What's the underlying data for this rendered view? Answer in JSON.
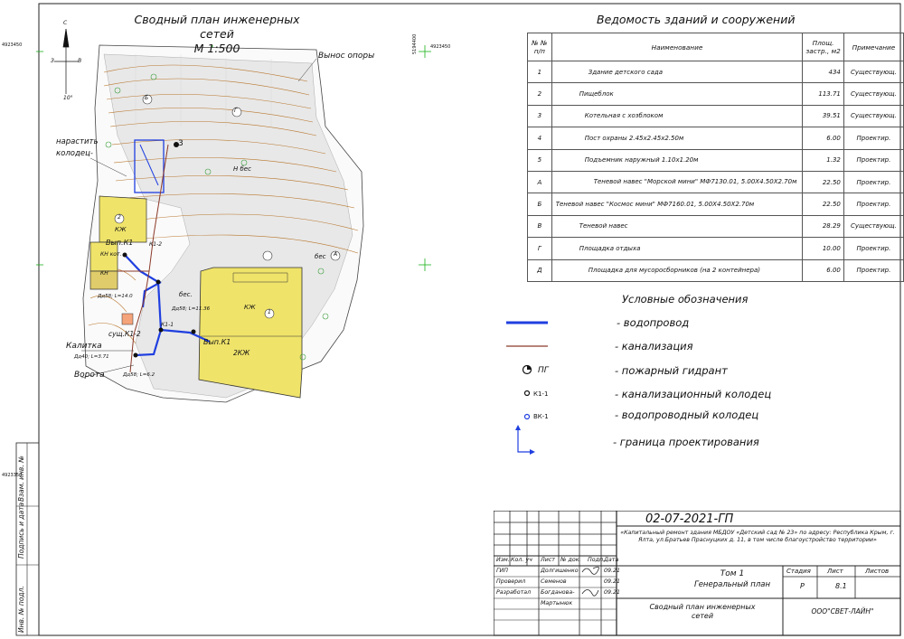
{
  "plan": {
    "title": "Сводный план инженерных сетей",
    "scale": "М 1:500",
    "labels": {
      "vynos_opory": "Вынос опоры",
      "narastit": "нарастить",
      "kolodets": "колодец-",
      "kalitka": "Калитка",
      "vorota": "Ворота",
      "vyp_k1_top": "Вып.К1",
      "vyp_k1_bottom": "Вып.К1",
      "susch_k1": "сущ.К1-2",
      "zh_small": "КЖ",
      "kn_kot": "КН кот.",
      "kn": "КН",
      "zh_big": "КЖ",
      "zh2": "2КЖ",
      "bes1": "бес",
      "bes2": "бес.",
      "bes3": "Н бес",
      "dim1": "Дд58; L=6.2",
      "dim2": "Дд40; L=3.71",
      "dim3": "Дд58; L=14.0",
      "dim4": "Дд58; L=11.36",
      "k1_1": "К1-1",
      "k1_2": "К1-2",
      "circle1": "1",
      "circle2": "2",
      "circleB": "Б",
      "circleA": "А",
      "circleG": "Г",
      "pg": "3",
      "north_s": "С",
      "north_yu": "Ю",
      "north_z": "З",
      "north_v": "В",
      "north_deg": "10°"
    },
    "coords": {
      "x1": "4923450",
      "x2": "4923350",
      "y1": "5194400",
      "y2": "4923450"
    }
  },
  "vedomost": {
    "title": "Ведомость зданий и сооружений",
    "headers": {
      "num": "№ № п/п",
      "name": "Наименование",
      "area": "Площ. застр., м2",
      "note": "Примечание"
    },
    "rows": [
      {
        "num": "1",
        "name": "Здание детского сада",
        "area": "434",
        "note": "Существующ."
      },
      {
        "num": "2",
        "name": "Пищеблок",
        "area": "113.71",
        "note": "Существующ."
      },
      {
        "num": "3",
        "name": "Котельная с хозблоком",
        "area": "39.51",
        "note": "Существующ."
      },
      {
        "num": "4",
        "name": "Пост охраны 2.45x2.45x2.50м",
        "area": "6.00",
        "note": "Проектир."
      },
      {
        "num": "5",
        "name": "Подъемник наружный 1.10x1.20м",
        "area": "1.32",
        "note": "Проектир."
      },
      {
        "num": "А",
        "name": "Теневой навес \"Морской мини\" МФ7130.01, 5.00X4.50X2.70м",
        "area": "22.50",
        "note": "Проектир."
      },
      {
        "num": "Б",
        "name": "Теневой навес \"Космос мини\" МФ7160.01, 5.00X4.50X2.70м",
        "area": "22.50",
        "note": "Проектир."
      },
      {
        "num": "В",
        "name": "Теневой навес",
        "area": "28.29",
        "note": "Существующ."
      },
      {
        "num": "Г",
        "name": "Площадка отдыха",
        "area": "10.00",
        "note": "Проектир."
      },
      {
        "num": "Д",
        "name": "Площадка для мусоросборников (на 2 контейнера)",
        "area": "6.00",
        "note": "Проектир."
      }
    ]
  },
  "legend": {
    "title": "Условные обозначения",
    "items": [
      {
        "key": "vodoprovod",
        "text": "- водопровод",
        "color": "#1f3fe0"
      },
      {
        "key": "kanalizatsiya",
        "text": "- канализация",
        "color": "#8b3a2a"
      },
      {
        "key": "gidrant",
        "symbol": "ПГ",
        "text": "- пожарный гидрант"
      },
      {
        "key": "kan_kolodets",
        "symbol": "К1-1",
        "text": "- канализационный колодец"
      },
      {
        "key": "vod_kolodets",
        "symbol": "ВК-1",
        "text": "- водопроводный колодец"
      },
      {
        "key": "granitsa",
        "text": "- граница проектирования"
      }
    ]
  },
  "stamp": {
    "code": "02-07-2021-ГП",
    "project": "«Капитальный ремонт здания МБДОУ «Детский сад № 23» по адресу: Республика Крым, г. Ялта, ул.Братьев Праснуцких д. 11, в том числе благоустройство территории»",
    "hdr": [
      "Изм.",
      "Кол. уч",
      "Лист",
      "№ док.",
      "Подп.",
      "Дата"
    ],
    "people": [
      {
        "role": "ГИП",
        "name": "Долгишенко",
        "date": "09.21"
      },
      {
        "role": "Проверил",
        "name": "Семенов",
        "date": "09.21"
      },
      {
        "role": "Разработал",
        "name": "Богданова-",
        "date": "09.21"
      },
      {
        "role": "",
        "name": "Мартынюк",
        "date": ""
      }
    ],
    "volume": "Том 1",
    "volume_name": "Генеральный план",
    "sheet_name": "Сводный план инженерных сетей",
    "stage_label": "Стадия",
    "sheet_label": "Лист",
    "sheets_label": "Листов",
    "stage": "Р",
    "sheet": "8.1",
    "sheets": "",
    "company": "ООО\"СВЕТ-ЛАЙН\""
  },
  "side": {
    "inv_podl": "Инв. № подл.",
    "podpis": "Подпись и дата",
    "vzam": "Взам. инв. №"
  },
  "colors": {
    "water": "#1f3fe0",
    "sewer": "#8b3a2a",
    "building_yellow": "#efe36a",
    "contour": "#b8762d",
    "green_cross": "#19b219"
  }
}
